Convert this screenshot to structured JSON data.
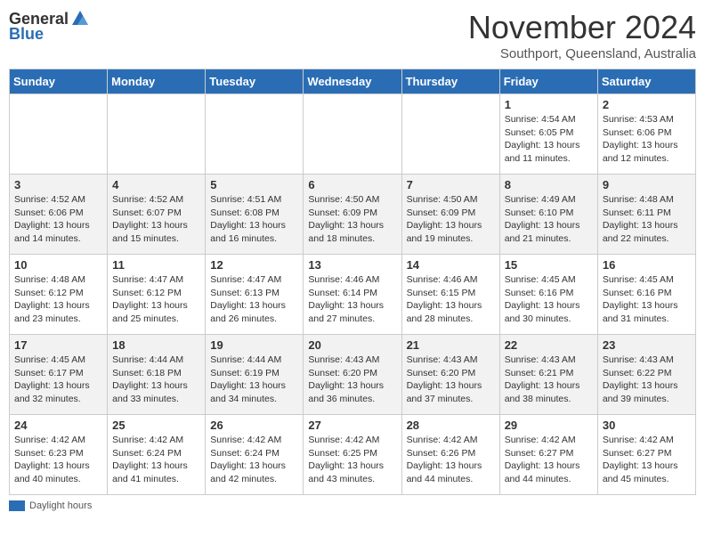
{
  "header": {
    "logo_general": "General",
    "logo_blue": "Blue",
    "month_title": "November 2024",
    "location": "Southport, Queensland, Australia"
  },
  "weekdays": [
    "Sunday",
    "Monday",
    "Tuesday",
    "Wednesday",
    "Thursday",
    "Friday",
    "Saturday"
  ],
  "weeks": [
    [
      {
        "day": "",
        "info": ""
      },
      {
        "day": "",
        "info": ""
      },
      {
        "day": "",
        "info": ""
      },
      {
        "day": "",
        "info": ""
      },
      {
        "day": "",
        "info": ""
      },
      {
        "day": "1",
        "info": "Sunrise: 4:54 AM\nSunset: 6:05 PM\nDaylight: 13 hours and 11 minutes."
      },
      {
        "day": "2",
        "info": "Sunrise: 4:53 AM\nSunset: 6:06 PM\nDaylight: 13 hours and 12 minutes."
      }
    ],
    [
      {
        "day": "3",
        "info": "Sunrise: 4:52 AM\nSunset: 6:06 PM\nDaylight: 13 hours and 14 minutes."
      },
      {
        "day": "4",
        "info": "Sunrise: 4:52 AM\nSunset: 6:07 PM\nDaylight: 13 hours and 15 minutes."
      },
      {
        "day": "5",
        "info": "Sunrise: 4:51 AM\nSunset: 6:08 PM\nDaylight: 13 hours and 16 minutes."
      },
      {
        "day": "6",
        "info": "Sunrise: 4:50 AM\nSunset: 6:09 PM\nDaylight: 13 hours and 18 minutes."
      },
      {
        "day": "7",
        "info": "Sunrise: 4:50 AM\nSunset: 6:09 PM\nDaylight: 13 hours and 19 minutes."
      },
      {
        "day": "8",
        "info": "Sunrise: 4:49 AM\nSunset: 6:10 PM\nDaylight: 13 hours and 21 minutes."
      },
      {
        "day": "9",
        "info": "Sunrise: 4:48 AM\nSunset: 6:11 PM\nDaylight: 13 hours and 22 minutes."
      }
    ],
    [
      {
        "day": "10",
        "info": "Sunrise: 4:48 AM\nSunset: 6:12 PM\nDaylight: 13 hours and 23 minutes."
      },
      {
        "day": "11",
        "info": "Sunrise: 4:47 AM\nSunset: 6:12 PM\nDaylight: 13 hours and 25 minutes."
      },
      {
        "day": "12",
        "info": "Sunrise: 4:47 AM\nSunset: 6:13 PM\nDaylight: 13 hours and 26 minutes."
      },
      {
        "day": "13",
        "info": "Sunrise: 4:46 AM\nSunset: 6:14 PM\nDaylight: 13 hours and 27 minutes."
      },
      {
        "day": "14",
        "info": "Sunrise: 4:46 AM\nSunset: 6:15 PM\nDaylight: 13 hours and 28 minutes."
      },
      {
        "day": "15",
        "info": "Sunrise: 4:45 AM\nSunset: 6:16 PM\nDaylight: 13 hours and 30 minutes."
      },
      {
        "day": "16",
        "info": "Sunrise: 4:45 AM\nSunset: 6:16 PM\nDaylight: 13 hours and 31 minutes."
      }
    ],
    [
      {
        "day": "17",
        "info": "Sunrise: 4:45 AM\nSunset: 6:17 PM\nDaylight: 13 hours and 32 minutes."
      },
      {
        "day": "18",
        "info": "Sunrise: 4:44 AM\nSunset: 6:18 PM\nDaylight: 13 hours and 33 minutes."
      },
      {
        "day": "19",
        "info": "Sunrise: 4:44 AM\nSunset: 6:19 PM\nDaylight: 13 hours and 34 minutes."
      },
      {
        "day": "20",
        "info": "Sunrise: 4:43 AM\nSunset: 6:20 PM\nDaylight: 13 hours and 36 minutes."
      },
      {
        "day": "21",
        "info": "Sunrise: 4:43 AM\nSunset: 6:20 PM\nDaylight: 13 hours and 37 minutes."
      },
      {
        "day": "22",
        "info": "Sunrise: 4:43 AM\nSunset: 6:21 PM\nDaylight: 13 hours and 38 minutes."
      },
      {
        "day": "23",
        "info": "Sunrise: 4:43 AM\nSunset: 6:22 PM\nDaylight: 13 hours and 39 minutes."
      }
    ],
    [
      {
        "day": "24",
        "info": "Sunrise: 4:42 AM\nSunset: 6:23 PM\nDaylight: 13 hours and 40 minutes."
      },
      {
        "day": "25",
        "info": "Sunrise: 4:42 AM\nSunset: 6:24 PM\nDaylight: 13 hours and 41 minutes."
      },
      {
        "day": "26",
        "info": "Sunrise: 4:42 AM\nSunset: 6:24 PM\nDaylight: 13 hours and 42 minutes."
      },
      {
        "day": "27",
        "info": "Sunrise: 4:42 AM\nSunset: 6:25 PM\nDaylight: 13 hours and 43 minutes."
      },
      {
        "day": "28",
        "info": "Sunrise: 4:42 AM\nSunset: 6:26 PM\nDaylight: 13 hours and 44 minutes."
      },
      {
        "day": "29",
        "info": "Sunrise: 4:42 AM\nSunset: 6:27 PM\nDaylight: 13 hours and 44 minutes."
      },
      {
        "day": "30",
        "info": "Sunrise: 4:42 AM\nSunset: 6:27 PM\nDaylight: 13 hours and 45 minutes."
      }
    ]
  ],
  "legend": {
    "daylight_label": "Daylight hours"
  }
}
